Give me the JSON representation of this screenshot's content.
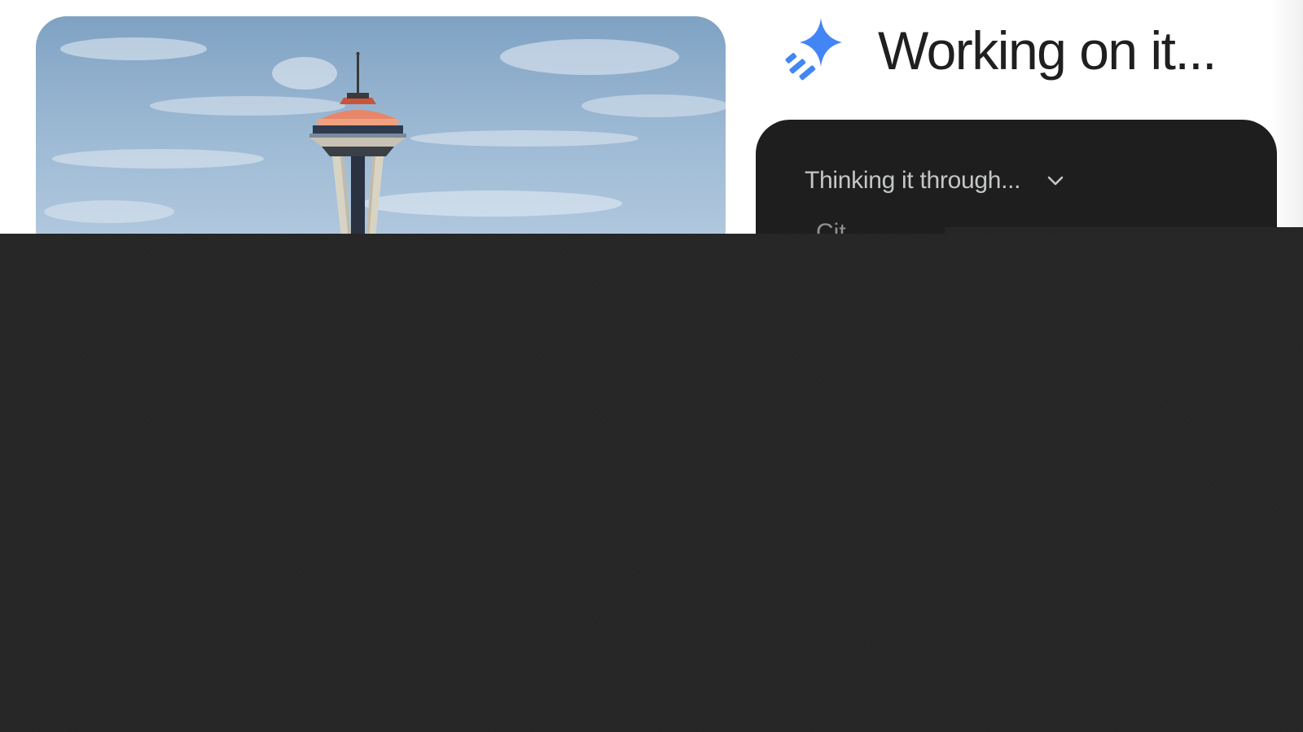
{
  "header": {
    "title": "Working on it...",
    "icon": "sparkle-icon",
    "icon_color": "#4285f4"
  },
  "photo": {
    "subject_icon": "space-needle-icon"
  },
  "thinking_panel": {
    "toggle_label": "Thinking it through...",
    "toggle_icon": "chevron-down-icon",
    "partial_text": "Cit..."
  },
  "colors": {
    "panel_bg": "#1e1e1e",
    "overlay_bg": "#262626",
    "title_text": "#1f1f1f",
    "panel_text": "#c4c7c5"
  }
}
